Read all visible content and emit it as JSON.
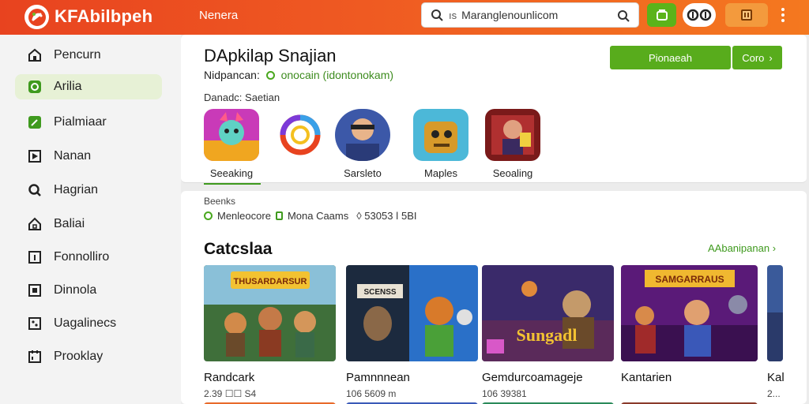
{
  "header": {
    "brand": "KFAbilbpeh",
    "nav_link": "Nenera",
    "search": {
      "value": "Maranglenounlicom",
      "prefix": "ıs"
    },
    "colors": {
      "header_start": "#e8431f",
      "header_end": "#f4781f",
      "accent_green": "#58ac1c"
    },
    "icons": [
      "search-icon",
      "store-icon",
      "profile-toggle-icon",
      "bookmark-icon",
      "more-menu-icon"
    ]
  },
  "sidebar": {
    "items": [
      {
        "label": "Pencurn",
        "icon": "home-icon",
        "active": false
      },
      {
        "label": "Arilia",
        "icon": "apps-icon",
        "active": true
      },
      {
        "label": "Pialmiaar",
        "icon": "edit-icon",
        "active": false
      },
      {
        "label": "Nanan",
        "icon": "play-icon",
        "active": false
      },
      {
        "label": "Hagrian",
        "icon": "search-icon",
        "active": false
      },
      {
        "label": "Baliai",
        "icon": "house-icon",
        "active": false
      },
      {
        "label": "Fonnolliro",
        "icon": "info-icon",
        "active": false
      },
      {
        "label": "Dinnola",
        "icon": "window-icon",
        "active": false
      },
      {
        "label": "Uagalinecs",
        "icon": "image-icon",
        "active": false
      },
      {
        "label": "Prooklay",
        "icon": "calendar-icon",
        "active": false
      }
    ]
  },
  "top_card": {
    "title": "DApkilap Snajian",
    "subtitle_label": "Nidpancan:",
    "subtitle_tag": "onocain (idontonokam)",
    "share_label": "Danadc: Saetian",
    "primary_button": "Pionaeah",
    "secondary_button": "Coro",
    "apps": [
      {
        "name": "Seeaking"
      },
      {
        "name": ""
      },
      {
        "name": "Sarsleto"
      },
      {
        "name": "Maples"
      },
      {
        "name": "Seoaling"
      }
    ]
  },
  "main_card": {
    "small_heading": "Beenks",
    "stats": {
      "a": "Menleocore",
      "b": "Mona Caams",
      "c": "◊ 53053 ǀ 5BI"
    },
    "section_title": "Catcslaa",
    "see_all": "AAbanipanan",
    "games": [
      {
        "title": "Randcark",
        "meta": "2.39 ☐☐ S4",
        "banner": "THUSARDARSUR"
      },
      {
        "title": "Pamnnnean",
        "meta": "106 5609 m",
        "banner": "SCENSS"
      },
      {
        "title": "Gemdurcoamageje",
        "meta": "106 39381",
        "banner": "Sungadl"
      },
      {
        "title": "Kantarien",
        "meta": "",
        "banner": "SAMGARRAUS"
      },
      {
        "title": "Kal",
        "meta": "2...",
        "banner": ""
      }
    ]
  }
}
